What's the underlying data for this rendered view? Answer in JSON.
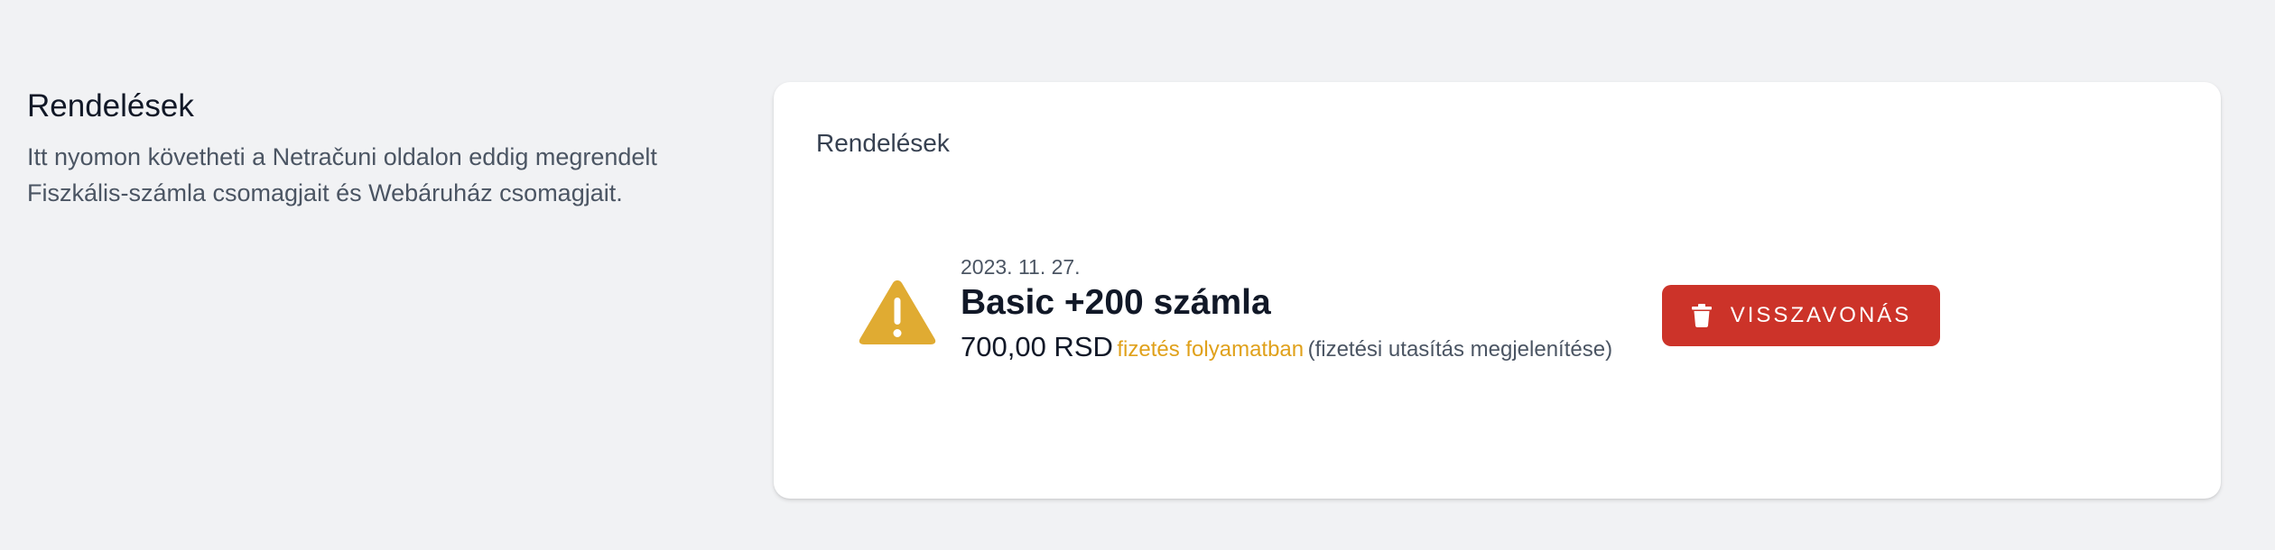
{
  "intro": {
    "title": "Rendelések",
    "description_line1": "Itt nyomon követheti a Netračuni oldalon eddig megrendelt",
    "description_line2": "Fiszkális-számla csomagjait és Webáruház csomagjait."
  },
  "card": {
    "title": "Rendelések"
  },
  "order": {
    "date": "2023. 11. 27.",
    "name": "Basic +200 számla",
    "price": "700,00 RSD",
    "status": "fizetés folyamatban",
    "instructions_link": "(fizetési utasítás megjelenítése)",
    "status_icon": "warning-icon",
    "status_color": "#e0a11b"
  },
  "actions": {
    "cancel_label": "VISSZAVONÁS",
    "cancel_icon": "trash-icon",
    "cancel_color": "#cc3329"
  }
}
